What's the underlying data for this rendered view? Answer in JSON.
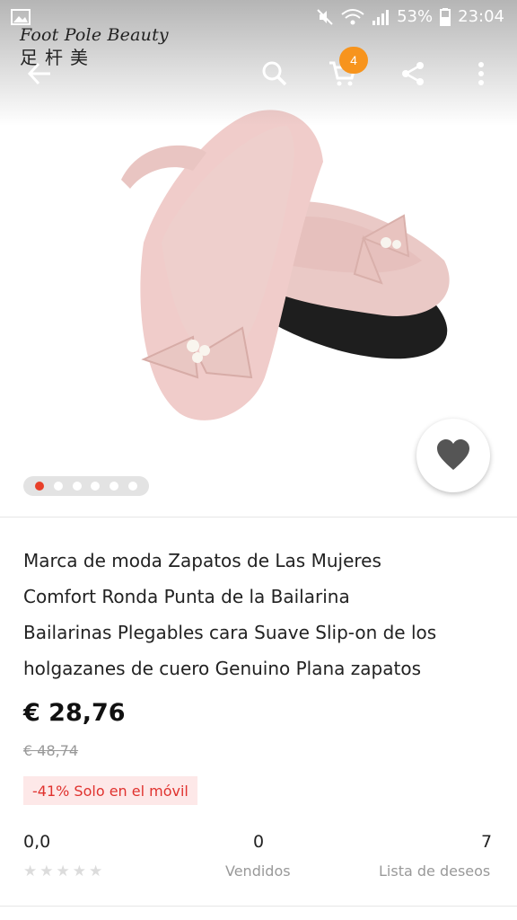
{
  "status_bar": {
    "battery": "53%",
    "time": "23:04"
  },
  "brand": {
    "latin": "Foot Pole Beauty",
    "cjk": "足杆美"
  },
  "toolbar": {
    "back_icon": "back-arrow-icon",
    "search_icon": "search-icon",
    "cart_icon": "cart-icon",
    "cart_count": "4",
    "share_icon": "share-icon",
    "more_icon": "more-vert-icon"
  },
  "carousel": {
    "total": 6,
    "active_index": 0
  },
  "colors": {
    "accent": "#e8402a",
    "badge": "#f7941d",
    "discount_text": "#e0322e",
    "discount_bg": "#fde8e8"
  },
  "product": {
    "title_lines": [
      "Marca de moda Zapatos de Las Mujeres",
      "Comfort Ronda Punta de la Bailarina",
      "Bailarinas Plegables cara Suave Slip-on de los",
      "holgazanes de cuero Genuino Plana zapatos"
    ],
    "price": "€ 28,76",
    "old_price": "€ 48,74",
    "discount": "-41% Solo en el móvil"
  },
  "stats": {
    "rating_value": "0,0",
    "rating_stars": 0,
    "sold_value": "0",
    "sold_label": "Vendidos",
    "wishlist_value": "7",
    "wishlist_label": "Lista de deseos"
  }
}
